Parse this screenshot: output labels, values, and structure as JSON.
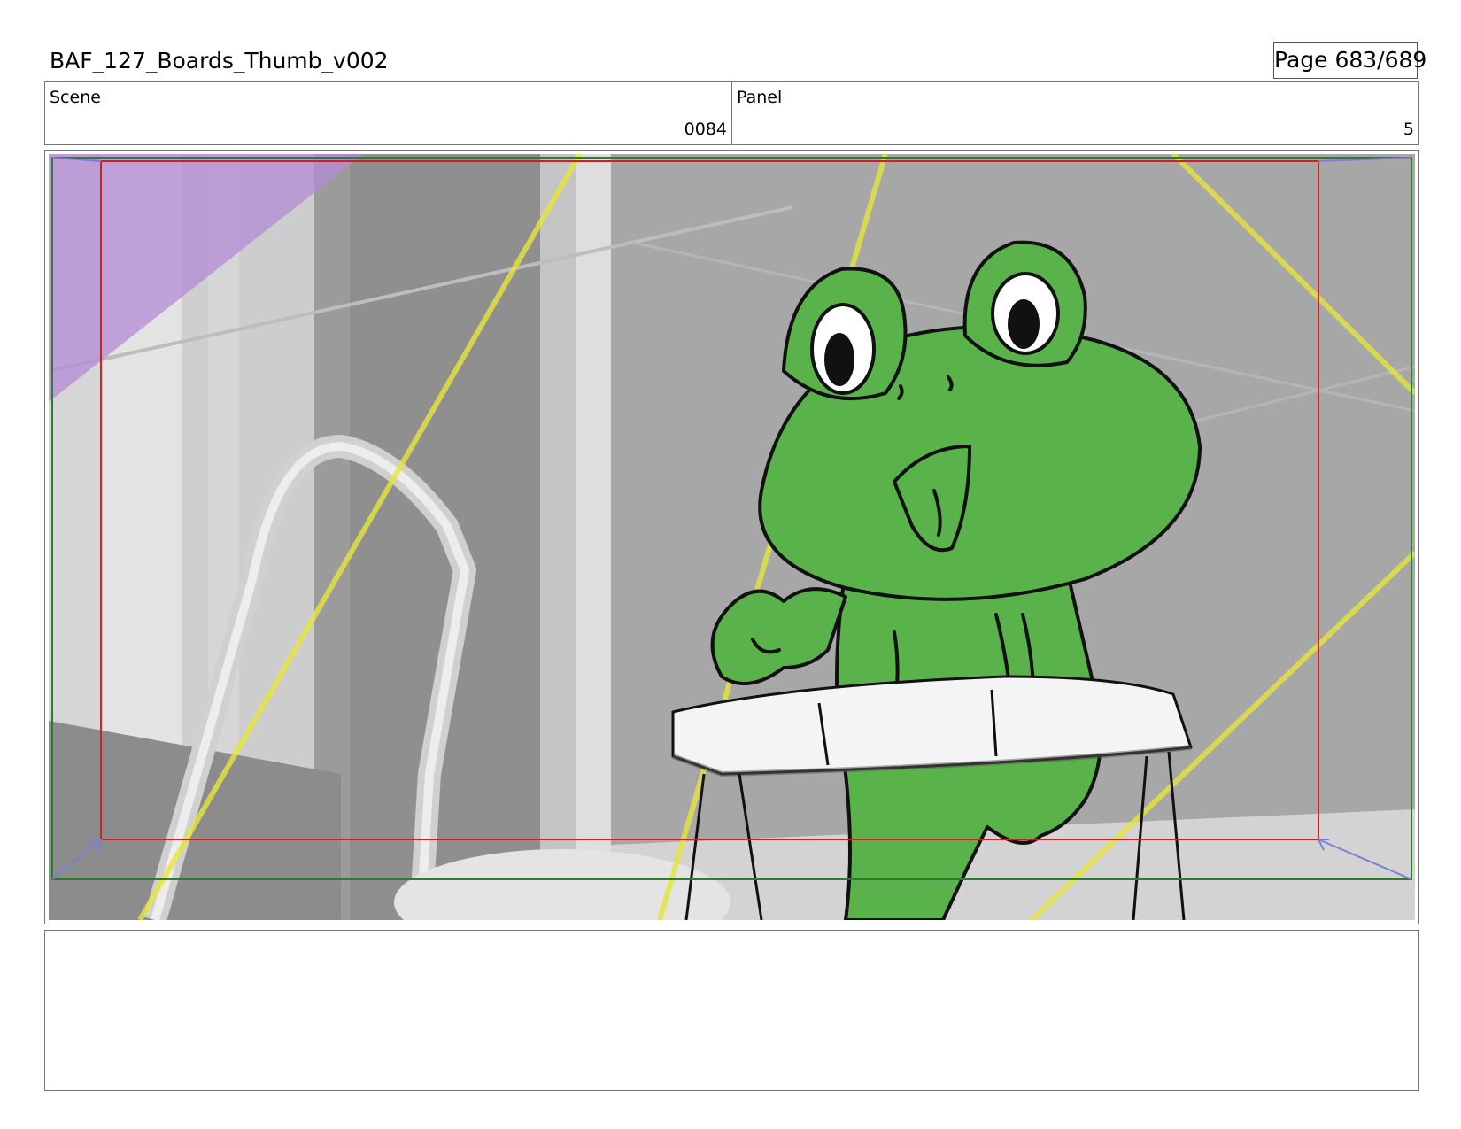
{
  "header": {
    "title": "BAF_127_Boards_Thumb_v002",
    "page": "Page 683/689"
  },
  "info": {
    "scene_label": "Scene",
    "scene_value": "0084",
    "panel_label": "Panel",
    "panel_value": "5"
  },
  "frame": {
    "safe_area_color": "#cc2222",
    "frame_guide_color": "#2e7d2e",
    "light_ray_color": "#e6e63a",
    "frog_color": "#5ab34a",
    "overlay_color": "#b48ad4",
    "icons": [
      "corner-arrow-icon"
    ]
  },
  "notes": {
    "text": ""
  }
}
